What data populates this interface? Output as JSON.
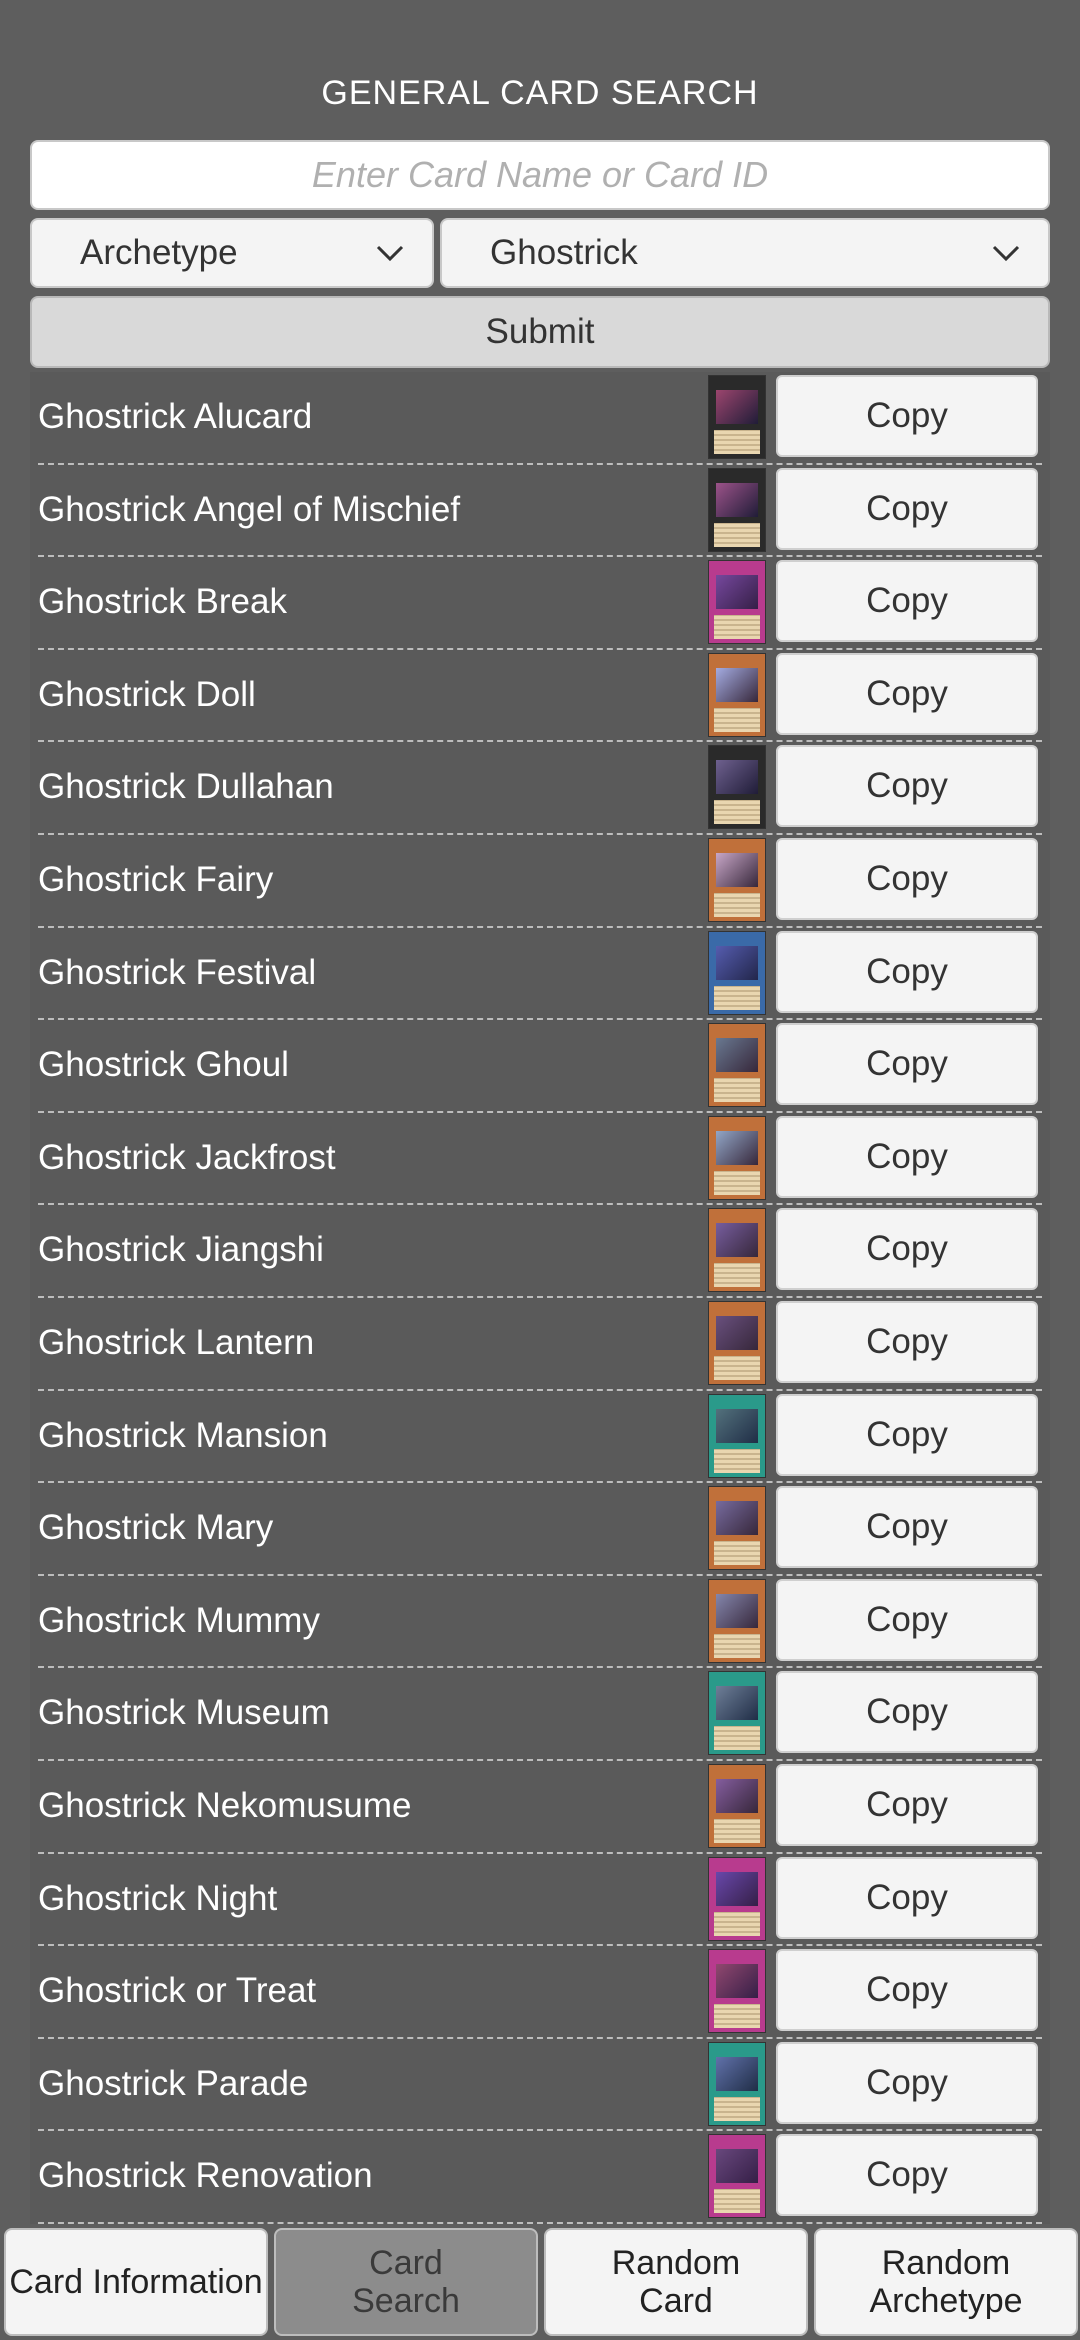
{
  "header": {
    "title": "GENERAL CARD SEARCH"
  },
  "search": {
    "placeholder": "Enter Card Name or Card ID",
    "value": ""
  },
  "filters": {
    "type": "Archetype",
    "archetype": "Ghostrick"
  },
  "submit_label": "Submit",
  "results": [
    {
      "name": "Ghostrick Alucard",
      "copy": "Copy",
      "frame": "#2a2a2a",
      "art": "#b04a7a"
    },
    {
      "name": "Ghostrick Angel of Mischief",
      "copy": "Copy",
      "frame": "#2a2a2a",
      "art": "#b05a9a"
    },
    {
      "name": "Ghostrick Break",
      "copy": "Copy",
      "frame": "#b83b8e",
      "art": "#6a4aa0"
    },
    {
      "name": "Ghostrick Doll",
      "copy": "Copy",
      "frame": "#c0703a",
      "art": "#9fb6ff"
    },
    {
      "name": "Ghostrick Dullahan",
      "copy": "Copy",
      "frame": "#2a2a2a",
      "art": "#7a6aa0"
    },
    {
      "name": "Ghostrick Fairy",
      "copy": "Copy",
      "frame": "#c0703a",
      "art": "#c9b0e0"
    },
    {
      "name": "Ghostrick Festival",
      "copy": "Copy",
      "frame": "#3a6aa8",
      "art": "#5a5ab0"
    },
    {
      "name": "Ghostrick Ghoul",
      "copy": "Copy",
      "frame": "#c0703a",
      "art": "#5a7aa0"
    },
    {
      "name": "Ghostrick Jackfrost",
      "copy": "Copy",
      "frame": "#c0703a",
      "art": "#8ab0e0"
    },
    {
      "name": "Ghostrick Jiangshi",
      "copy": "Copy",
      "frame": "#c0703a",
      "art": "#6a5ab0"
    },
    {
      "name": "Ghostrick Lantern",
      "copy": "Copy",
      "frame": "#c0703a",
      "art": "#5a4a8a"
    },
    {
      "name": "Ghostrick Mansion",
      "copy": "Copy",
      "frame": "#2a9a8a",
      "art": "#5a6a7a"
    },
    {
      "name": "Ghostrick Mary",
      "copy": "Copy",
      "frame": "#c0703a",
      "art": "#6a6ab0"
    },
    {
      "name": "Ghostrick Mummy",
      "copy": "Copy",
      "frame": "#c0703a",
      "art": "#7a8ac0"
    },
    {
      "name": "Ghostrick Museum",
      "copy": "Copy",
      "frame": "#2a9a8a",
      "art": "#7a7a9a"
    },
    {
      "name": "Ghostrick Nekomusume",
      "copy": "Copy",
      "frame": "#c0703a",
      "art": "#7a5ab0"
    },
    {
      "name": "Ghostrick Night",
      "copy": "Copy",
      "frame": "#b83b8e",
      "art": "#5a4ab0"
    },
    {
      "name": "Ghostrick or Treat",
      "copy": "Copy",
      "frame": "#b83b8e",
      "art": "#8a4a6a"
    },
    {
      "name": "Ghostrick Parade",
      "copy": "Copy",
      "frame": "#2a9a8a",
      "art": "#6a6ab0"
    },
    {
      "name": "Ghostrick Renovation",
      "copy": "Copy",
      "frame": "#b83b8e",
      "art": "#5a4a7a"
    }
  ],
  "nav": {
    "card_information": "Card Information",
    "card_search": "Card\nSearch",
    "random_card": "Random\nCard",
    "random_archetype": "Random\nArchetype"
  }
}
